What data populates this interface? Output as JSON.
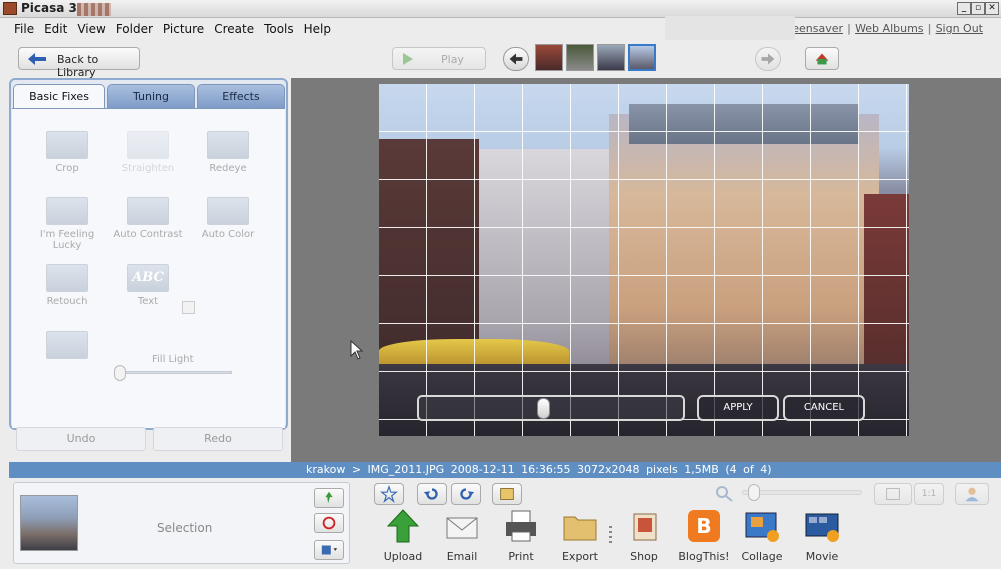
{
  "window": {
    "title": "Picasa 3",
    "controls": [
      "_",
      "▫",
      "✕"
    ]
  },
  "menu": [
    "File",
    "Edit",
    "View",
    "Folder",
    "Picture",
    "Create",
    "Tools",
    "Help"
  ],
  "top_links": [
    "Screensaver",
    "Web Albums",
    "Sign Out"
  ],
  "toolbar": {
    "back_label": "Back to Library",
    "play_label": "Play"
  },
  "left_panel": {
    "tabs": [
      "Basic Fixes",
      "Tuning",
      "Effects"
    ],
    "active_tab": "Basic Fixes",
    "tools": [
      "Crop",
      "Straighten",
      "Redeye",
      "I'm Feeling Lucky",
      "Auto Contrast",
      "Auto Color",
      "Retouch",
      "Text"
    ],
    "text_icon_label": "ABC",
    "fill_light_label": "Fill Light",
    "undo_label": "Undo",
    "redo_label": "Redo"
  },
  "photo_overlay": {
    "apply_label": "APPLY",
    "cancel_label": "CANCEL",
    "slider_position": 0.47
  },
  "info": {
    "path": "krakow > IMG_2011.JPG",
    "datetime": "2008-12-11 16:36:55",
    "dimensions": "3072x2048 pixels",
    "size": "1,5MB",
    "count": "(4 of 4)"
  },
  "tray": {
    "selection_label": "Selection"
  },
  "actions": [
    "Upload",
    "Email",
    "Print",
    "Export",
    "Shop",
    "BlogThis!",
    "Collage",
    "Movie"
  ],
  "zoom": {
    "ratio_label": "1:1",
    "slider_position": 0.05
  },
  "colors": {
    "accent": "#5f8fc2",
    "panel_border": "#8fa9cf",
    "play_green": "#5caa4a"
  }
}
